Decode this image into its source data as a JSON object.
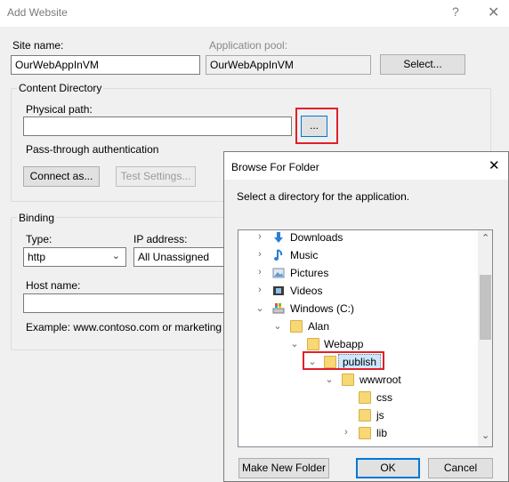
{
  "dialog": {
    "title": "Add Website",
    "help_glyph": "?",
    "close_glyph": "✕",
    "site_name_label": "Site name:",
    "site_name_value": "OurWebAppInVM",
    "app_pool_label": "Application pool:",
    "app_pool_value": "OurWebAppInVM",
    "select_button": "Select...",
    "content_directory_legend": "Content Directory",
    "physical_path_label": "Physical path:",
    "physical_path_value": "",
    "browse_button": "...",
    "passthrough_label": "Pass-through authentication",
    "connect_as_button": "Connect as...",
    "test_settings_button": "Test Settings...",
    "binding_legend": "Binding",
    "type_label": "Type:",
    "type_value": "http",
    "ip_label": "IP address:",
    "ip_value": "All Unassigned",
    "host_name_label": "Host name:",
    "host_name_value": "",
    "example_text": "Example: www.contoso.com or marketing"
  },
  "browse": {
    "title": "Browse For Folder",
    "close_glyph": "✕",
    "instruction": "Select a directory for the application.",
    "tree": [
      {
        "label": "Downloads",
        "icon": "downloads-icon",
        "twisty": "›"
      },
      {
        "label": "Music",
        "icon": "music-icon",
        "twisty": "›"
      },
      {
        "label": "Pictures",
        "icon": "pictures-icon",
        "twisty": "›"
      },
      {
        "label": "Videos",
        "icon": "videos-icon",
        "twisty": "›"
      },
      {
        "label": "Windows (C:)",
        "icon": "drive-icon",
        "twisty": "⌄"
      },
      {
        "label": "Alan",
        "icon": "folder-icon",
        "twisty": "⌄"
      },
      {
        "label": "Webapp",
        "icon": "folder-icon",
        "twisty": "⌄"
      },
      {
        "label": "publish",
        "icon": "folder-icon",
        "twisty": "⌄",
        "selected": true
      },
      {
        "label": "wwwroot",
        "icon": "folder-icon",
        "twisty": "⌄"
      },
      {
        "label": "css",
        "icon": "folder-icon",
        "twisty": ""
      },
      {
        "label": "js",
        "icon": "folder-icon",
        "twisty": ""
      },
      {
        "label": "lib",
        "icon": "folder-icon",
        "twisty": "›"
      }
    ],
    "scroll_up_glyph": "⌃",
    "scroll_down_glyph": "⌄",
    "make_new_folder_button": "Make New Folder",
    "ok_button": "OK",
    "cancel_button": "Cancel"
  },
  "colors": {
    "highlight": "#e0202a",
    "selection": "#cce8ff",
    "accent": "#0078d7",
    "folder": "#f8d775"
  }
}
